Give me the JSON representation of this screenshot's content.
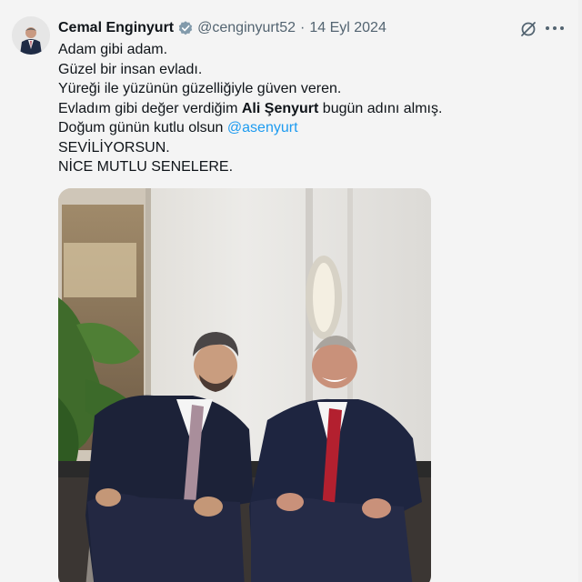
{
  "tweet": {
    "author_name": "Cemal Enginyurt",
    "handle": "@cenginyurt52",
    "separator": "·",
    "date": "14 Eyl 2024",
    "lines": [
      "Adam gibi adam.",
      "Güzel bir insan evladı.",
      "Yüreği ile yüzünün güzelliğiyle güven veren."
    ],
    "line4_pre": "Evladım gibi değer verdiğim ",
    "line4_bold": "Ali Şenyurt",
    "line4_post": " bugün adını almış.",
    "line5_pre": "Doğum günün kutlu olsun ",
    "line5_mention": "@asenyurt",
    "line6": "SEVİLİYORSUN.",
    "line7": "NİCE MUTLU SENELERE."
  },
  "icons": {
    "verified": "verified-badge-icon",
    "grok": "grok-icon",
    "more": "more-options-icon"
  },
  "colors": {
    "text": "#0f1419",
    "secondary": "#536471",
    "link": "#1d9bf0",
    "background": "#f4f4f4"
  }
}
